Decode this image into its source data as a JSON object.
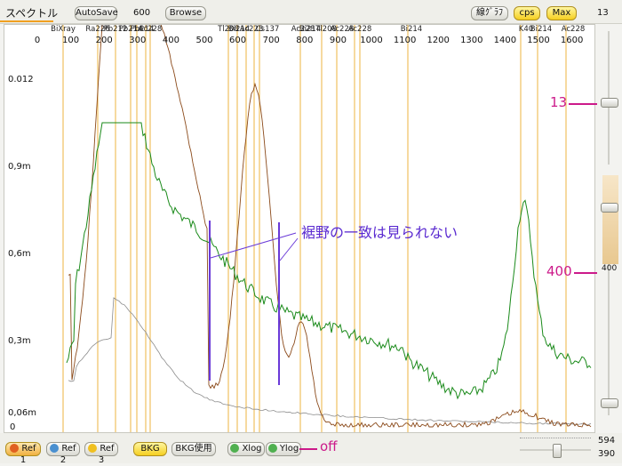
{
  "header": {
    "title": "スペクトル",
    "autosave_label": "AutoSave",
    "autosave_value": "600",
    "browse_label": "Browse",
    "linegraph_label": "線ｸﾞﾗﾌ",
    "cps_label": "cps",
    "max_label": "Max",
    "top_right_value": "13"
  },
  "plot": {
    "y_labels": [
      "0.012",
      "0,9m",
      "0,6m",
      "0,3m",
      "0,06m",
      "0"
    ],
    "x_ticks": [
      "0",
      "100",
      "200",
      "300",
      "400",
      "500",
      "600",
      "700",
      "800",
      "900",
      "1000",
      "1100",
      "1200",
      "1300",
      "1400",
      "1500",
      "1600"
    ],
    "isotopes": [
      "BiXray",
      "Ra226",
      "Pb212",
      "Pb214",
      "Ac228",
      "Pb214",
      "Tl208",
      "Bi214",
      "Ac228",
      "Cs137",
      "Ac228",
      "Bi214",
      "Tl208",
      "Ac228",
      "Ac228",
      "Bi214",
      "K40",
      "Bi214",
      "Ac228"
    ],
    "annotation_text": "裾野の一致は見られない",
    "colors": {
      "green": "#1a8a1a",
      "brown": "#8b4a1a",
      "gray": "#888888",
      "isotope_line": "#f0c060",
      "annotation": "#6a3ad8"
    }
  },
  "right_panel": {
    "anno_13": "13",
    "anno_400": "400",
    "value_400": "400",
    "value_594": "594",
    "value_390": "390"
  },
  "bottom": {
    "ref1": "Ref 1",
    "ref2": "Ref 2",
    "ref3": "Ref 3",
    "bkg": "BKG",
    "bkg_use": "BKG使用",
    "xlog": "Xlog",
    "ylog": "Ylog",
    "off_anno": "off"
  }
}
